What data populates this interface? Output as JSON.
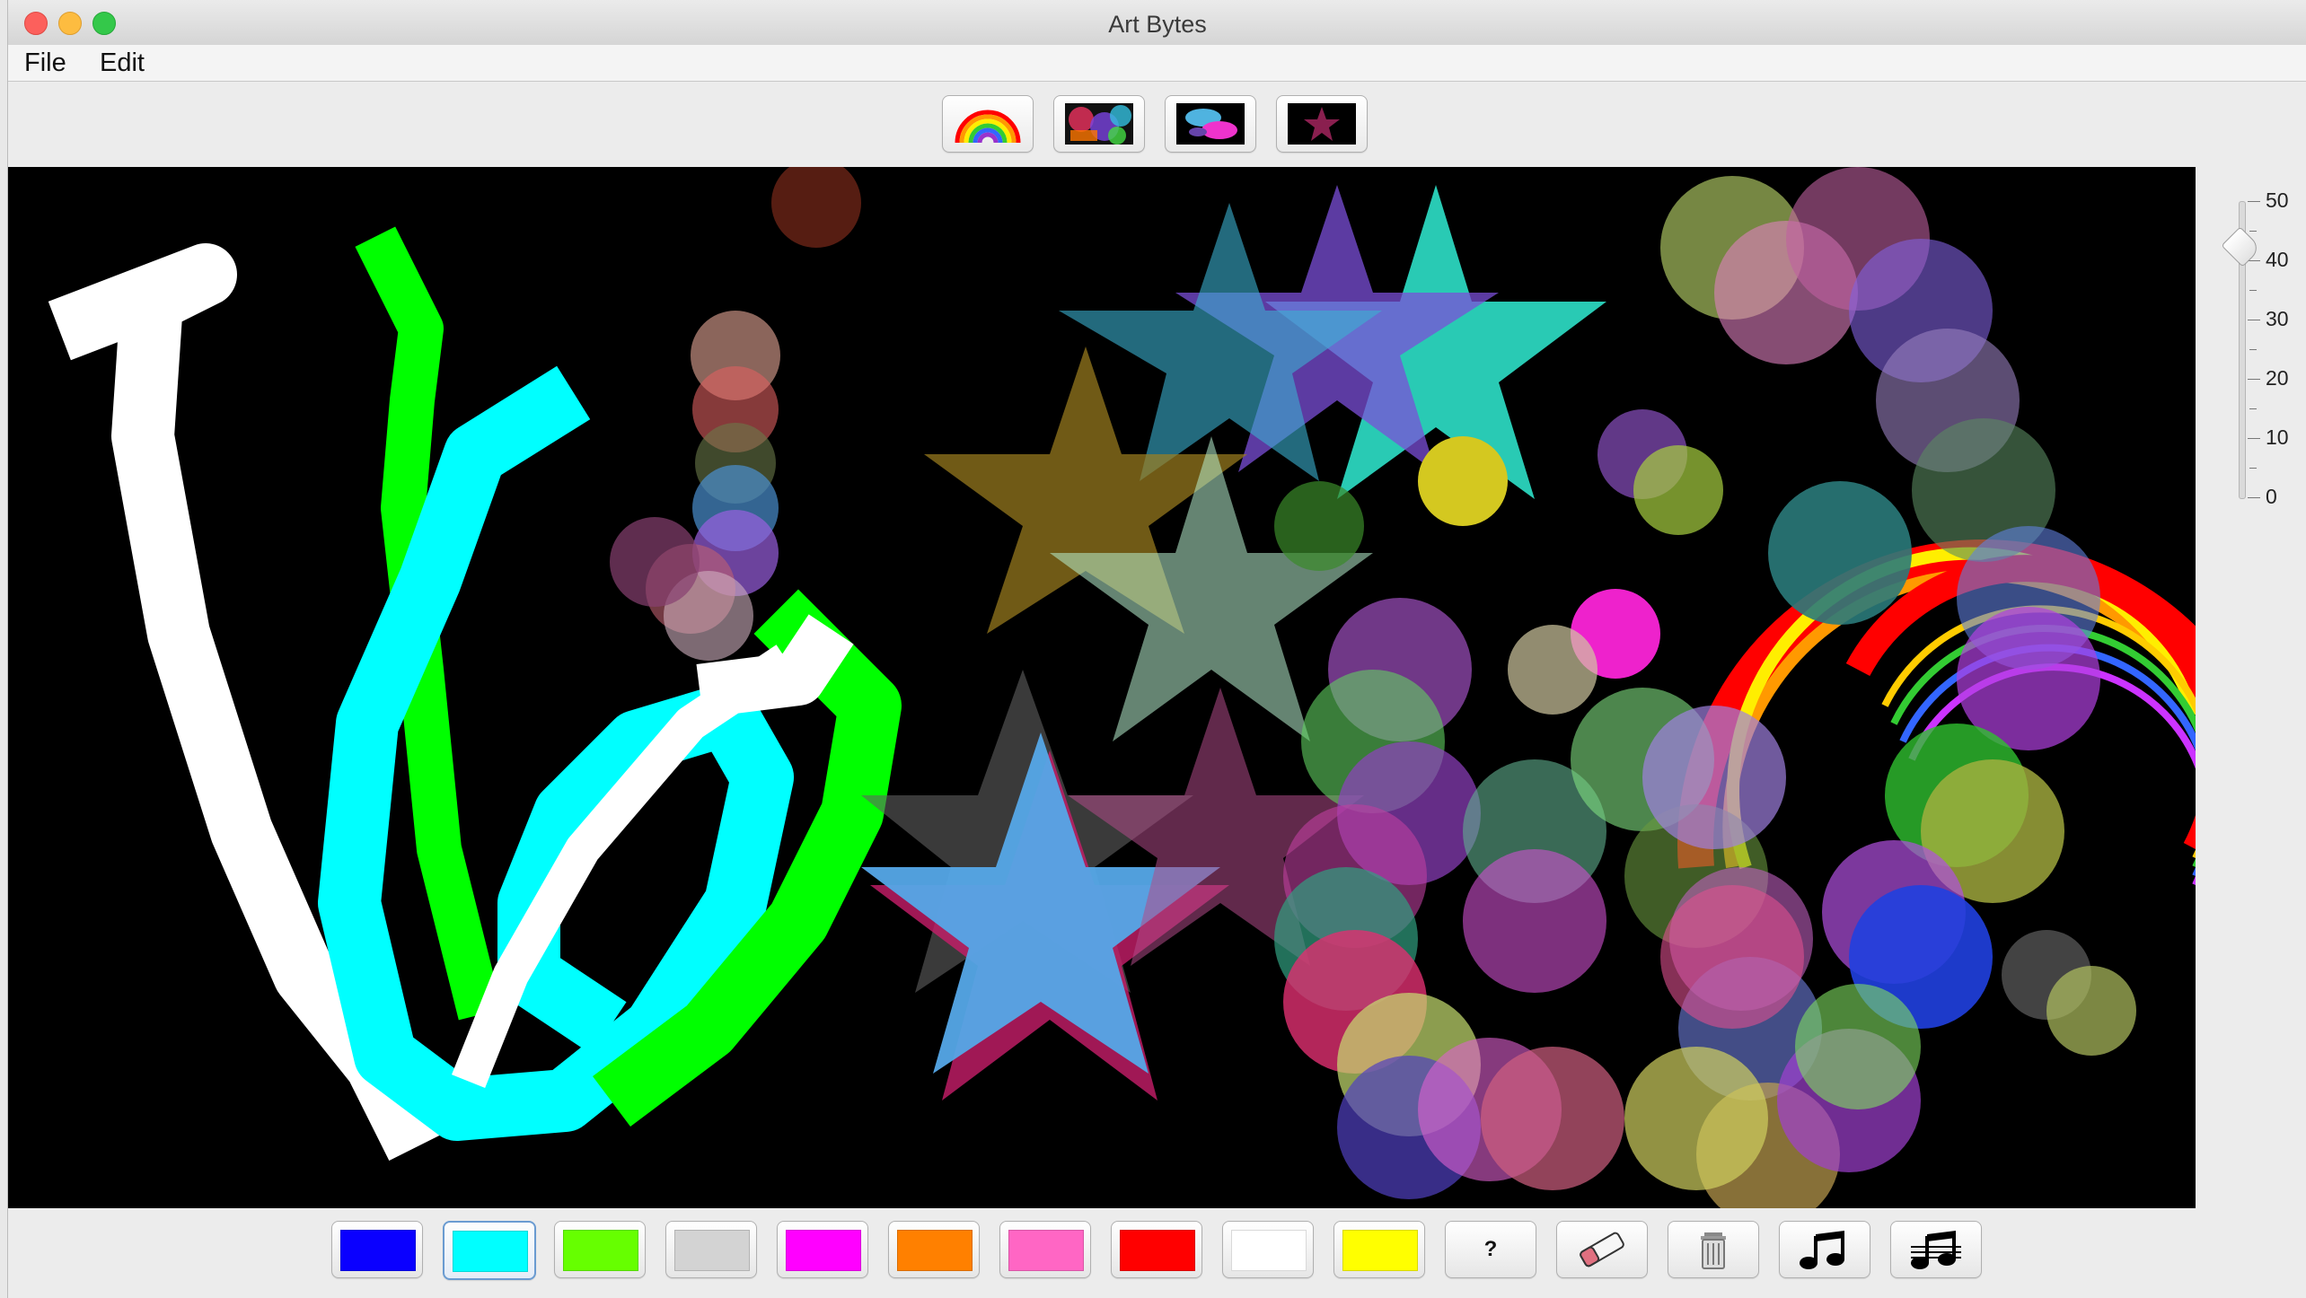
{
  "window": {
    "title": "Art Bytes"
  },
  "menu": {
    "file": "File",
    "edit": "Edit"
  },
  "stamps": [
    {
      "name": "rainbow-stamp"
    },
    {
      "name": "collage-stamp"
    },
    {
      "name": "ovals-stamp"
    },
    {
      "name": "star-stamp"
    }
  ],
  "size_slider": {
    "value": 40,
    "min": 0,
    "max": 50,
    "tick_labels": [
      "50",
      "40",
      "30",
      "20",
      "10",
      "0"
    ]
  },
  "palette": {
    "colors": [
      "#0a00ff",
      "#00ffff",
      "#66ff00",
      "#d3d3d3",
      "#ff00ff",
      "#ff8000",
      "#ff66c4",
      "#ff0000",
      "#ffffff",
      "#ffff00"
    ],
    "selected_index": 1,
    "random_label": "?",
    "tools": [
      "eraser-icon",
      "trash-icon",
      "music-note-icon",
      "music-note-muted-icon"
    ]
  },
  "canvas": {
    "background": "#000000"
  }
}
